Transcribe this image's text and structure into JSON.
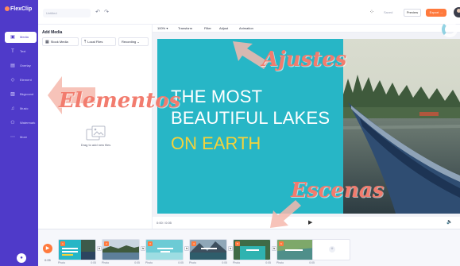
{
  "app": {
    "logo": "FlexClip"
  },
  "sidebar": {
    "items": [
      {
        "label": "Media",
        "icon": "media-icon",
        "glyph": "▣",
        "active": true
      },
      {
        "label": "Text",
        "icon": "text-icon",
        "glyph": "T",
        "active": false
      },
      {
        "label": "Overlay",
        "icon": "overlay-icon",
        "glyph": "▤",
        "active": false
      },
      {
        "label": "Element",
        "icon": "element-icon",
        "glyph": "◇",
        "active": false
      },
      {
        "label": "Bkground",
        "icon": "background-icon",
        "glyph": "▨",
        "active": false
      },
      {
        "label": "Music",
        "icon": "music-icon",
        "glyph": "♫",
        "active": false
      },
      {
        "label": "Watermark",
        "icon": "watermark-icon",
        "glyph": "⚇",
        "active": false
      },
      {
        "label": "More",
        "icon": "more-icon",
        "glyph": "⋯",
        "active": false
      }
    ]
  },
  "topbar": {
    "project_name": "Untitled",
    "undo": "↶",
    "redo": "↷",
    "grid": "⁘",
    "saved": "Saved",
    "preview": "Preview",
    "export": "Export →"
  },
  "media_panel": {
    "title": "Add Media",
    "tabs": [
      {
        "label": "Stock Media",
        "glyph": "▦"
      },
      {
        "label": "Local Files",
        "glyph": "⤒"
      },
      {
        "label": "Recording ⌄",
        "glyph": ""
      }
    ],
    "drop_label": "Drag to add new files",
    "collapse": "‹"
  },
  "editor_toolbar": {
    "items": [
      "100% ▾",
      "Transform",
      "Filter",
      "Adjust",
      "Animation"
    ]
  },
  "canvas": {
    "headline_lines": [
      "THE MOST",
      "BEAUTIFUL LAKES"
    ],
    "subline": "ON EARTH",
    "colors": {
      "text_panel": "#27b6c6",
      "subline": "#f4d23b",
      "headline": "#ffffff"
    }
  },
  "player": {
    "time": "0:00 / 0:05",
    "play": "▶",
    "volume": "🔈"
  },
  "timeline": {
    "play": "▶",
    "duration": "0:05",
    "scenes": [
      {
        "num": "1",
        "label": "Photo",
        "duration": "0:05",
        "style": "lake-boat"
      },
      {
        "num": "2",
        "label": "Photo",
        "duration": "0:05",
        "style": "lake-forest"
      },
      {
        "num": "3",
        "label": "Photo",
        "duration": "0:05",
        "style": "teal-title"
      },
      {
        "num": "4",
        "label": "Photo",
        "duration": "0:05",
        "style": "mountain-lake"
      },
      {
        "num": "5",
        "label": "Photo",
        "duration": "0:05",
        "style": "turquoise-lake"
      },
      {
        "num": "6",
        "label": "Photo",
        "duration": "0:05",
        "style": "green-lake"
      }
    ],
    "transition_glyph": "⇆",
    "add_glyph": "+"
  },
  "annotations": {
    "ajustes": "Ajustes",
    "elementos": "Elementos",
    "escenas": "Escenas",
    "color": "#f27c6e"
  }
}
